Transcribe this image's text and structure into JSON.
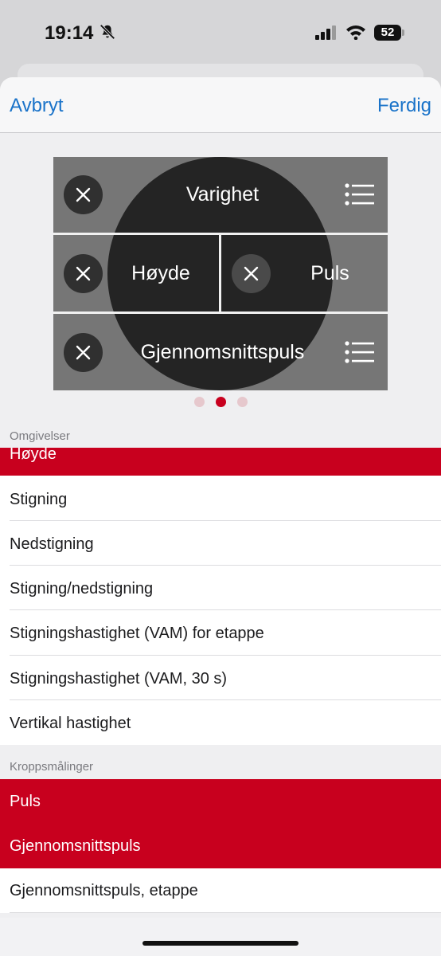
{
  "status": {
    "time": "19:14",
    "battery": "52",
    "icons": [
      "bell-slash-icon",
      "signal-icon",
      "wifi-icon",
      "battery-icon"
    ]
  },
  "nav": {
    "cancel": "Avbryt",
    "done": "Ferdig"
  },
  "preview": {
    "top_field": "Varighet",
    "middle_left": "Høyde",
    "middle_right": "Puls",
    "bottom_field": "Gjennomsnittspuls",
    "page_count": 3,
    "active_page": 2
  },
  "sections": [
    {
      "header": "Omgivelser",
      "items": [
        {
          "label": "Høyde",
          "selected": true
        },
        {
          "label": "Stigning",
          "selected": false
        },
        {
          "label": "Nedstigning",
          "selected": false
        },
        {
          "label": "Stigning/nedstigning",
          "selected": false
        },
        {
          "label": "Stigningshastighet (VAM) for etappe",
          "selected": false
        },
        {
          "label": "Stigningshastighet (VAM, 30 s)",
          "selected": false
        },
        {
          "label": "Vertikal hastighet",
          "selected": false
        }
      ]
    },
    {
      "header": "Kroppsmålinger",
      "items": [
        {
          "label": "Puls",
          "selected": true
        },
        {
          "label": "Gjennomsnittspuls",
          "selected": true
        },
        {
          "label": "Gjennomsnittspuls, etappe",
          "selected": false
        }
      ]
    }
  ],
  "colors": {
    "accent": "#c8001e",
    "link": "#1a73c9"
  }
}
